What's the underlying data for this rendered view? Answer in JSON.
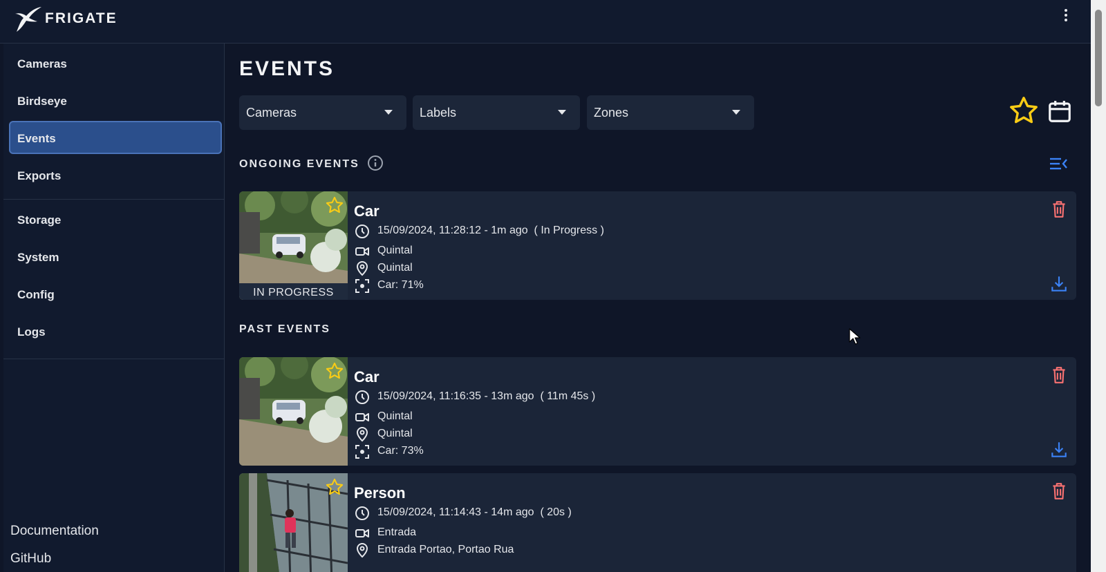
{
  "app": {
    "brand": "FRIGATE"
  },
  "sidebar": {
    "items": [
      {
        "label": "Cameras"
      },
      {
        "label": "Birdseye"
      },
      {
        "label": "Events"
      },
      {
        "label": "Exports"
      },
      {
        "label": "Storage"
      },
      {
        "label": "System"
      },
      {
        "label": "Config"
      },
      {
        "label": "Logs"
      }
    ],
    "active": "Events",
    "footer": [
      {
        "label": "Documentation"
      },
      {
        "label": "GitHub"
      }
    ]
  },
  "main": {
    "title": "EVENTS",
    "filters": [
      {
        "label": "Cameras"
      },
      {
        "label": "Labels"
      },
      {
        "label": "Zones"
      }
    ],
    "ongoing_title": "ONGOING EVENTS",
    "past_title": "PAST EVENTS",
    "ongoing_events": [
      {
        "label": "Car",
        "time": "15/09/2024, 11:28:12 - 1m ago  ( In Progress )",
        "camera": "Quintal",
        "zones": "Quintal",
        "score": "Car: 71%",
        "badge": "IN PROGRESS"
      }
    ],
    "past_events": [
      {
        "label": "Car",
        "time": "15/09/2024, 11:16:35 - 13m ago  ( 11m 45s )",
        "camera": "Quintal",
        "zones": "Quintal",
        "score": "Car: 73%"
      },
      {
        "label": "Person",
        "time": "15/09/2024, 11:14:43 - 14m ago  ( 20s )",
        "camera": "Entrada",
        "zones": "Entrada Portao, Portao Rua"
      }
    ]
  },
  "colors": {
    "background": "#0f1628",
    "accent": "#2b4f8c",
    "star": "#facc15",
    "delete": "#f87171",
    "download": "#3b82f6"
  },
  "icons": [
    "frigate-logo-icon",
    "kebab-menu-icon",
    "star-icon",
    "calendar-icon",
    "info-icon",
    "collapse-list-icon",
    "clock-icon",
    "camera-icon",
    "location-pin-icon",
    "object-detect-icon",
    "trash-icon",
    "download-icon"
  ]
}
